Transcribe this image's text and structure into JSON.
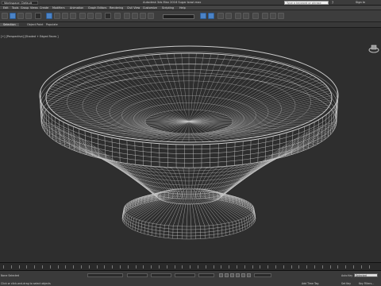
{
  "titlebar": {
    "workspace": "Workspace: Default",
    "title": "Autodesk 3ds Max 2016     Sugar bowl.max",
    "search_placeholder": "Type a keyword or phrase",
    "sign_in": "Sign In",
    "help_icon": "help-icon"
  },
  "menubar": {
    "items": [
      "Edit",
      "Tools",
      "Group",
      "Views",
      "Create",
      "Modifiers",
      "Animation",
      "Graph Editors",
      "Rendering",
      "Civil View",
      "Customize",
      "Scripting",
      "Help"
    ]
  },
  "ribbon": {
    "tabs": [
      "Selection",
      "Object Paint",
      "Populate"
    ]
  },
  "viewport": {
    "label": "[+] [Perspective] [Shaded + Edged Faces ]"
  },
  "statusbar": {
    "selection": "None Selected",
    "prompt": "Click or click-and-drag to select objects",
    "auto_key": "Auto Key",
    "auto_key_value": "Selected",
    "set_key": "Set Key",
    "key_filters": "Key Filters...",
    "add_time_tag": "Add Time Tag"
  },
  "colors": {
    "viewport_bg": "#2e2e2e",
    "wire": "#c9c9c9",
    "accent": "#4b83c6"
  }
}
